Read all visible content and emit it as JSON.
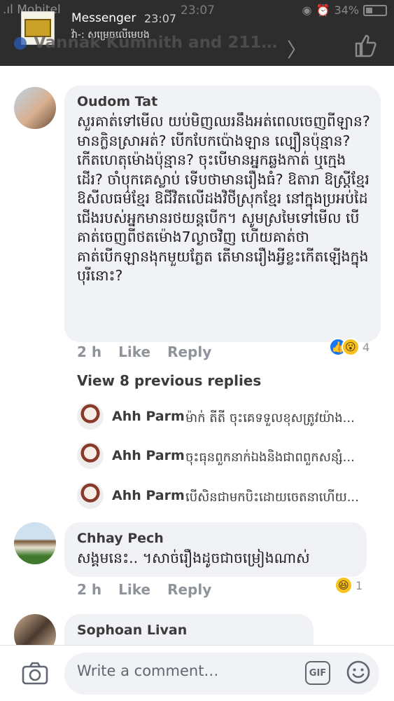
{
  "status_bar": {
    "carrier": ".ıl Mobitel",
    "time": "23:07",
    "battery": "34%"
  },
  "notification": {
    "app": "Messenger",
    "time": "23:07",
    "text": "វ៉ា-: សម្រេចលើមេបង"
  },
  "post_header": {
    "reactors_text": "Vannak Kumnith and 211…"
  },
  "comments": [
    {
      "author": "Oudom Tat",
      "text": "សួរគាត់ទៅមើល យប់មិញឈរនឹងអត់ពេលចេញពីឡាន? មានក្លិនស្រាអត់? បើកបែកប៉ោងឡាន ល្បឿនប៉ុន្មាន? កើតហេតុម៉ោងប៉ុន្មាន? ចុះបើមានអ្នកឆ្លងកាត់ ឬក្មេងដើរ? ចាំបុកគេស្លាប់ ទើបថាមានរឿងធំ? ឱតារា ឱស្ត្រីខ្មែរ ឱសីលធម៌ខ្មែរ ឱជីវិតលើដងវិថីស្រុកខ្មែរ នៅក្នុងប្រអប់ដៃ ជើងរបស់អ្នកមានរថយន្តបើក។ សូមស្រមៃទៅមើល បើគាត់ចេញពីថតម៉ោង7ល្ងាចវិញ ហើយគាត់ថា គាត់បើកឡានងុកមួយភ្លែត តើមានរឿងអ្វីខ្លះកើតឡើងក្នុងបុរីនោះ?",
      "time": "2 h",
      "like": "Like",
      "reply": "Reply",
      "reaction_count": "4"
    },
    {
      "author": "Chhay Pech",
      "text": "សង្គមនេះ.. ។សាច់រឿងដូចជាចម្រៀងណាស់",
      "time": "2 h",
      "like": "Like",
      "reply": "Reply",
      "reaction_count": "1"
    },
    {
      "author": "Sophoan Livan"
    }
  ],
  "view_previous": "View 8 previous replies",
  "replies": [
    {
      "author": "Ahh Parm",
      "text": "ម៉ាក់ តីតី ចុះគេទទួលខុសត្រូវយ៉ាង..."
    },
    {
      "author": "Ahh Parm",
      "text": "ចុះធុនពួកនាក់ឯងនិងជាពពួកសន្សំ..."
    },
    {
      "author": "Ahh Parm",
      "text": "បើសិនជាមកបិះដោយចេតនាហើយ..."
    }
  ],
  "composer": {
    "placeholder": "Write a comment…",
    "gif_label": "GIF"
  },
  "colors": {
    "topbar": "#2d2d2d",
    "bubble": "#f0f2f5",
    "like_blue": "#1877f2",
    "meta_gray": "#8f939a"
  }
}
